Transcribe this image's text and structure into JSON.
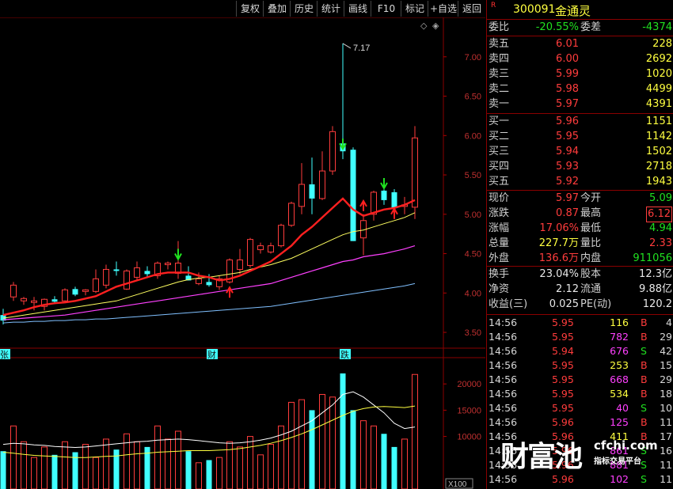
{
  "toolbar": {
    "buttons": [
      "复权",
      "叠加",
      "历史",
      "统计",
      "画线",
      "F10",
      "标记",
      "+自选",
      "返回"
    ]
  },
  "stock": {
    "badge": "R",
    "code": "300091",
    "name": "金通灵"
  },
  "weibi": {
    "label1": "委比",
    "value1": "-20.55%",
    "label2": "委差",
    "value2": "-4374"
  },
  "sells": [
    {
      "label": "卖五",
      "price": "6.01",
      "vol": "228"
    },
    {
      "label": "卖四",
      "price": "6.00",
      "vol": "2692"
    },
    {
      "label": "卖三",
      "price": "5.99",
      "vol": "1020"
    },
    {
      "label": "卖二",
      "price": "5.98",
      "vol": "4499"
    },
    {
      "label": "卖一",
      "price": "5.97",
      "vol": "4391"
    }
  ],
  "buys": [
    {
      "label": "买一",
      "price": "5.96",
      "vol": "1151"
    },
    {
      "label": "买二",
      "price": "5.95",
      "vol": "1142"
    },
    {
      "label": "买三",
      "price": "5.94",
      "vol": "1502"
    },
    {
      "label": "买四",
      "price": "5.93",
      "vol": "2718"
    },
    {
      "label": "买五",
      "price": "5.92",
      "vol": "1943"
    }
  ],
  "quote": [
    {
      "l1": "现价",
      "v1": "5.97",
      "l2": "今开",
      "v2": "5.09"
    },
    {
      "l1": "涨跌",
      "v1": "0.87",
      "l2": "最高",
      "v2": "6.12"
    },
    {
      "l1": "涨幅",
      "v1": "17.06%",
      "l2": "最低",
      "v2": "4.94"
    },
    {
      "l1": "总量",
      "v1": "227.7万",
      "l2": "量比",
      "v2": "2.33"
    },
    {
      "l1": "外盘",
      "v1": "136.6万",
      "l2": "内盘",
      "v2": "911056"
    }
  ],
  "finance": [
    {
      "l1": "换手",
      "v1": "23.04%",
      "l2": "股本",
      "v2": "12.3亿"
    },
    {
      "l1": "净资",
      "v1": "2.12",
      "l2": "流通",
      "v2": "9.88亿"
    },
    {
      "l1": "收益(三)",
      "v1": "0.025",
      "l2": "PE(动)",
      "v2": "120.2"
    }
  ],
  "ticks": [
    {
      "time": "14:56",
      "price": "5.95",
      "vol": "116",
      "side": "B",
      "cnt": "4"
    },
    {
      "time": "14:56",
      "price": "5.95",
      "vol": "782",
      "side": "B",
      "cnt": "29"
    },
    {
      "time": "14:56",
      "price": "5.94",
      "vol": "676",
      "side": "S",
      "cnt": "42"
    },
    {
      "time": "14:56",
      "price": "5.95",
      "vol": "253",
      "side": "B",
      "cnt": "15"
    },
    {
      "time": "14:56",
      "price": "5.95",
      "vol": "668",
      "side": "B",
      "cnt": "29"
    },
    {
      "time": "14:56",
      "price": "5.95",
      "vol": "534",
      "side": "B",
      "cnt": "18"
    },
    {
      "time": "14:56",
      "price": "5.95",
      "vol": "40",
      "side": "S",
      "cnt": "10"
    },
    {
      "time": "14:56",
      "price": "5.96",
      "vol": "125",
      "side": "B",
      "cnt": "11"
    },
    {
      "time": "14:56",
      "price": "5.96",
      "vol": "411",
      "side": "B",
      "cnt": "17"
    },
    {
      "time": "14:56",
      "price": "5.96",
      "vol": "861",
      "side": "S",
      "cnt": "16"
    },
    {
      "time": "14:56",
      "price": "5.96",
      "vol": "881",
      "side": "S",
      "cnt": "11"
    },
    {
      "time": "14:56",
      "price": "5.96",
      "vol": "102",
      "side": "S",
      "cnt": "11"
    }
  ],
  "watermark": {
    "big": "财富池",
    "site": "cfchi.com",
    "sub": "指标交易平台"
  },
  "chart_data": {
    "type": "candlestick",
    "price_ylim": [
      3.4,
      7.4
    ],
    "price_ticks": [
      "7.00",
      "6.50",
      "6.00",
      "5.50",
      "5.00",
      "4.50",
      "4.00",
      "3.50"
    ],
    "max_label": "7.17",
    "volume_ticks": [
      "20000",
      "15000",
      "10000"
    ],
    "volume_unit": "X100",
    "markers": [
      "张",
      "财",
      "跌"
    ],
    "candles": [
      {
        "o": 3.72,
        "h": 3.8,
        "l": 3.6,
        "c": 3.65
      },
      {
        "o": 3.95,
        "h": 4.14,
        "l": 3.9,
        "c": 4.1
      },
      {
        "o": 3.9,
        "h": 3.95,
        "l": 3.85,
        "c": 3.93
      },
      {
        "o": 3.88,
        "h": 3.95,
        "l": 3.78,
        "c": 3.9
      },
      {
        "o": 3.83,
        "h": 3.93,
        "l": 3.78,
        "c": 3.92
      },
      {
        "o": 3.92,
        "h": 3.96,
        "l": 3.86,
        "c": 3.89
      },
      {
        "o": 3.9,
        "h": 4.06,
        "l": 3.89,
        "c": 4.04
      },
      {
        "o": 4.05,
        "h": 4.08,
        "l": 3.96,
        "c": 3.98
      },
      {
        "o": 4.02,
        "h": 4.05,
        "l": 3.97,
        "c": 4.04
      },
      {
        "o": 4.02,
        "h": 4.3,
        "l": 4.0,
        "c": 4.18
      },
      {
        "o": 4.1,
        "h": 4.36,
        "l": 4.06,
        "c": 4.3
      },
      {
        "o": 4.3,
        "h": 4.4,
        "l": 4.22,
        "c": 4.28
      },
      {
        "o": 4.05,
        "h": 4.3,
        "l": 4.04,
        "c": 4.28
      },
      {
        "o": 4.2,
        "h": 4.4,
        "l": 4.15,
        "c": 4.32
      },
      {
        "o": 4.28,
        "h": 4.34,
        "l": 4.2,
        "c": 4.24
      },
      {
        "o": 4.22,
        "h": 4.4,
        "l": 4.18,
        "c": 4.38
      },
      {
        "o": 4.36,
        "h": 4.4,
        "l": 4.3,
        "c": 4.38
      },
      {
        "o": 4.25,
        "h": 4.66,
        "l": 4.18,
        "c": 4.38
      },
      {
        "o": 4.22,
        "h": 4.34,
        "l": 4.16,
        "c": 4.16
      },
      {
        "o": 4.12,
        "h": 4.26,
        "l": 4.1,
        "c": 4.18
      },
      {
        "o": 4.14,
        "h": 4.24,
        "l": 4.08,
        "c": 4.1
      },
      {
        "o": 4.08,
        "h": 4.22,
        "l": 4.04,
        "c": 4.18
      },
      {
        "o": 4.14,
        "h": 4.44,
        "l": 4.12,
        "c": 4.42
      },
      {
        "o": 4.3,
        "h": 4.56,
        "l": 4.24,
        "c": 4.42
      },
      {
        "o": 4.35,
        "h": 4.7,
        "l": 4.32,
        "c": 4.68
      },
      {
        "o": 4.55,
        "h": 4.64,
        "l": 4.5,
        "c": 4.6
      },
      {
        "o": 4.52,
        "h": 4.64,
        "l": 4.5,
        "c": 4.6
      },
      {
        "o": 4.6,
        "h": 4.88,
        "l": 4.58,
        "c": 4.86
      },
      {
        "o": 4.86,
        "h": 5.16,
        "l": 4.84,
        "c": 5.14
      },
      {
        "o": 5.1,
        "h": 5.65,
        "l": 5.0,
        "c": 5.38
      },
      {
        "o": 5.38,
        "h": 5.72,
        "l": 5.0,
        "c": 5.2
      },
      {
        "o": 5.2,
        "h": 5.8,
        "l": 5.18,
        "c": 5.55
      },
      {
        "o": 5.55,
        "h": 6.12,
        "l": 5.5,
        "c": 6.05
      },
      {
        "o": 5.9,
        "h": 7.17,
        "l": 5.7,
        "c": 5.8
      },
      {
        "o": 5.82,
        "h": 5.85,
        "l": 4.66,
        "c": 4.66
      },
      {
        "o": 4.7,
        "h": 5.0,
        "l": 4.48,
        "c": 4.92
      },
      {
        "o": 5.0,
        "h": 5.3,
        "l": 4.92,
        "c": 5.28
      },
      {
        "o": 5.3,
        "h": 5.45,
        "l": 5.12,
        "c": 5.18
      },
      {
        "o": 5.28,
        "h": 5.32,
        "l": 5.04,
        "c": 5.08
      },
      {
        "o": 5.1,
        "h": 5.22,
        "l": 5.0,
        "c": 5.12
      },
      {
        "o": 5.09,
        "h": 6.12,
        "l": 4.94,
        "c": 5.97
      }
    ],
    "ma5": [
      3.72,
      3.75,
      3.78,
      3.82,
      3.85,
      3.87,
      3.88,
      3.9,
      3.93,
      3.96,
      4.02,
      4.08,
      4.12,
      4.16,
      4.2,
      4.24,
      4.26,
      4.26,
      4.26,
      4.22,
      4.2,
      4.16,
      4.18,
      4.22,
      4.28,
      4.34,
      4.4,
      4.5,
      4.6,
      4.74,
      4.84,
      4.96,
      5.08,
      5.2,
      5.06,
      4.98,
      5.02,
      5.06,
      5.08,
      5.12,
      5.18
    ],
    "ma10": [
      3.68,
      3.7,
      3.72,
      3.74,
      3.76,
      3.78,
      3.8,
      3.82,
      3.84,
      3.86,
      3.88,
      3.9,
      3.94,
      3.98,
      4.02,
      4.06,
      4.1,
      4.14,
      4.17,
      4.19,
      4.2,
      4.22,
      4.24,
      4.26,
      4.3,
      4.33,
      4.36,
      4.4,
      4.44,
      4.5,
      4.56,
      4.62,
      4.68,
      4.74,
      4.78,
      4.8,
      4.84,
      4.88,
      4.92,
      4.96,
      5.02
    ],
    "ma20": [
      3.66,
      3.67,
      3.68,
      3.69,
      3.7,
      3.71,
      3.72,
      3.74,
      3.76,
      3.78,
      3.8,
      3.82,
      3.84,
      3.86,
      3.88,
      3.9,
      3.92,
      3.94,
      3.96,
      3.98,
      4.0,
      4.02,
      4.04,
      4.06,
      4.08,
      4.1,
      4.12,
      4.16,
      4.2,
      4.24,
      4.28,
      4.32,
      4.36,
      4.4,
      4.42,
      4.46,
      4.48,
      4.5,
      4.53,
      4.56,
      4.6
    ],
    "ma60": [
      3.62,
      3.63,
      3.63,
      3.64,
      3.64,
      3.65,
      3.65,
      3.66,
      3.66,
      3.67,
      3.67,
      3.68,
      3.69,
      3.7,
      3.71,
      3.72,
      3.73,
      3.74,
      3.75,
      3.76,
      3.77,
      3.78,
      3.79,
      3.8,
      3.81,
      3.82,
      3.83,
      3.85,
      3.87,
      3.89,
      3.91,
      3.93,
      3.95,
      3.97,
      3.99,
      4.01,
      4.03,
      4.05,
      4.07,
      4.09,
      4.12
    ],
    "volume": [
      7200,
      12000,
      9000,
      6000,
      8000,
      6500,
      9000,
      7000,
      8500,
      6000,
      9500,
      7500,
      10500,
      9000,
      8000,
      12000,
      9500,
      11000,
      7200,
      5000,
      5500,
      6000,
      9000,
      8000,
      10000,
      6500,
      8500,
      12000,
      16500,
      17000,
      15000,
      18000,
      17500,
      22000,
      15000,
      13000,
      12000,
      10500,
      8000,
      9500,
      21800
    ],
    "vol_ma1": [
      8500,
      8700,
      8600,
      8400,
      8300,
      8100,
      8000,
      7900,
      8000,
      8200,
      8400,
      8600,
      8800,
      9000,
      9100,
      9300,
      9400,
      9500,
      9400,
      9200,
      9000,
      8800,
      8700,
      8800,
      9000,
      9300,
      9700,
      10300,
      11000,
      12000,
      13000,
      14500,
      16000,
      18000,
      18500,
      17500,
      16000,
      14500,
      12500,
      11500,
      11800
    ],
    "vol_ma2": [
      7000,
      6800,
      6600,
      6400,
      6300,
      6200,
      6100,
      6000,
      6000,
      6100,
      6200,
      6300,
      6500,
      6700,
      6800,
      7000,
      7100,
      7200,
      7300,
      7300,
      7300,
      7400,
      7500,
      7700,
      8000,
      8300,
      8700,
      9200,
      9800,
      10500,
      11300,
      12200,
      13100,
      14000,
      14800,
      15300,
      15600,
      15700,
      15600,
      15500,
      15800
    ]
  }
}
